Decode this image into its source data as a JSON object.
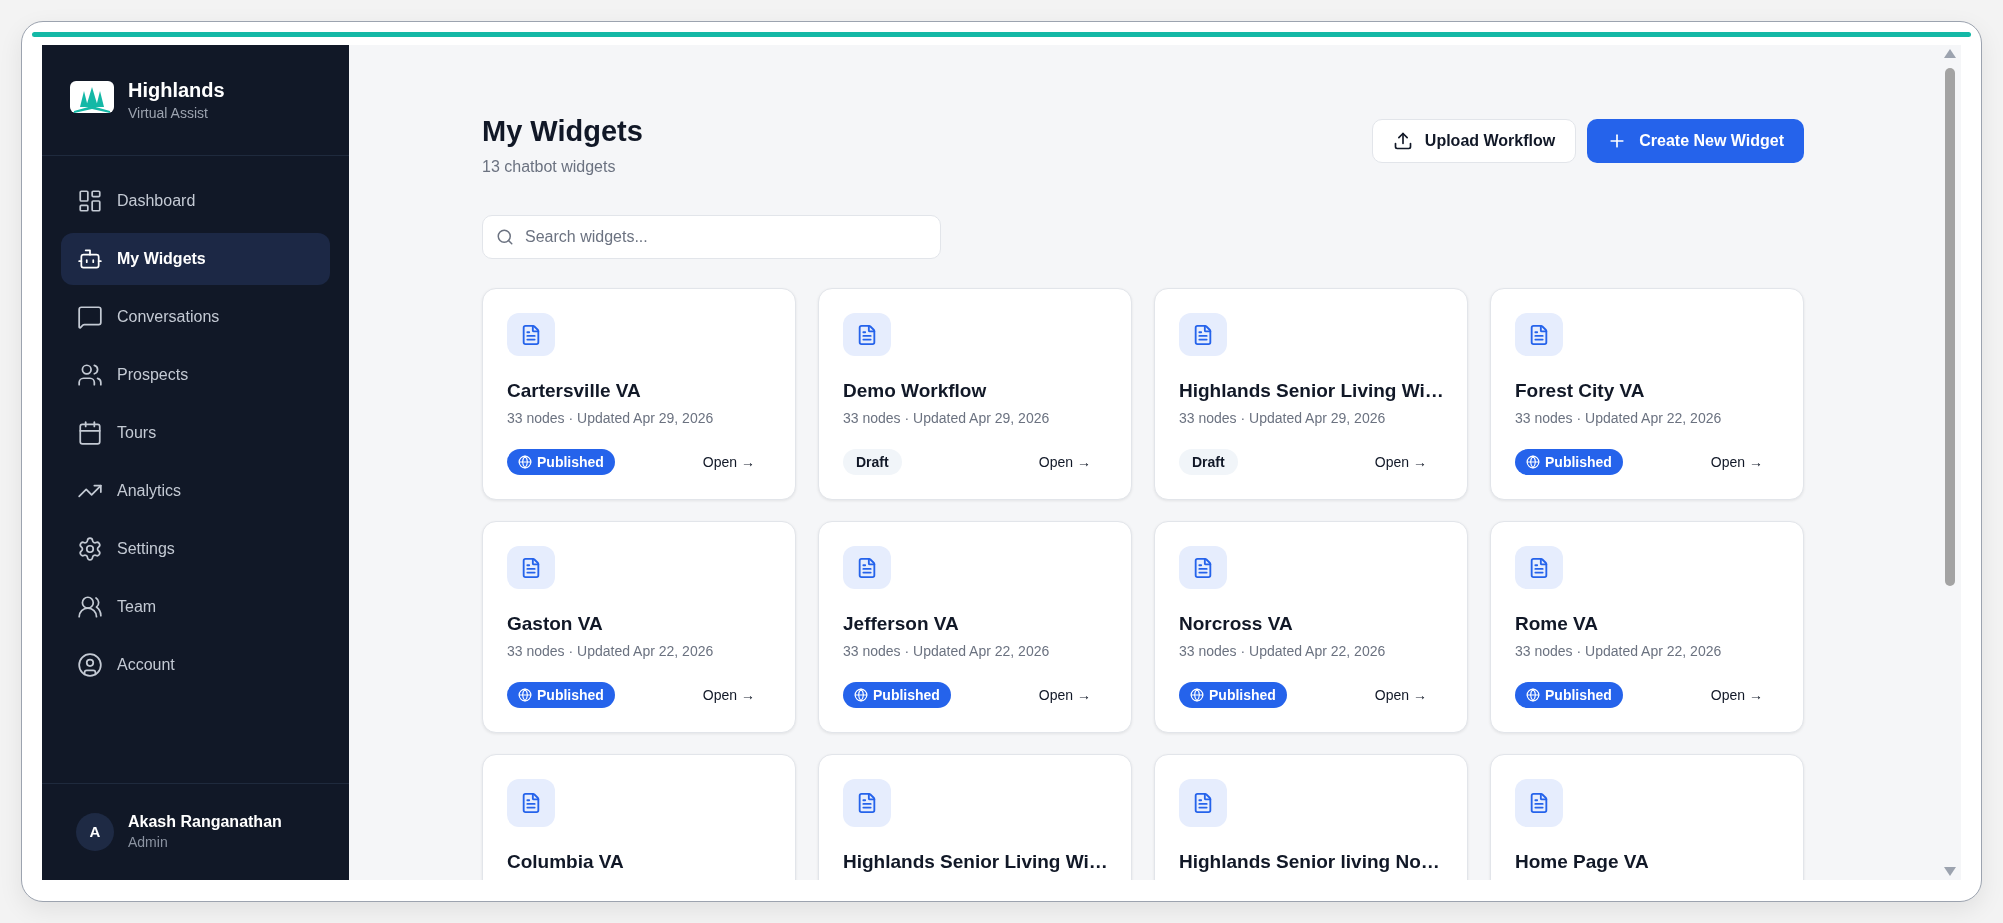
{
  "brand": {
    "name": "Highlands",
    "tagline": "Virtual Assist"
  },
  "sidebar": {
    "items": [
      {
        "label": "Dashboard",
        "selected": false
      },
      {
        "label": "My Widgets",
        "selected": true
      },
      {
        "label": "Conversations",
        "selected": false
      },
      {
        "label": "Prospects",
        "selected": false
      },
      {
        "label": "Tours",
        "selected": false
      },
      {
        "label": "Analytics",
        "selected": false
      },
      {
        "label": "Settings",
        "selected": false
      },
      {
        "label": "Team",
        "selected": false
      },
      {
        "label": "Account",
        "selected": false
      }
    ],
    "user": {
      "initial": "A",
      "name": "Akash Ranganathan",
      "role": "Admin"
    }
  },
  "header": {
    "title": "My Widgets",
    "subtitle": "13 chatbot widgets",
    "buttons": [
      {
        "label": "Upload Workflow",
        "kind": "secondary"
      },
      {
        "label": "Create New Widget",
        "kind": "primary"
      }
    ]
  },
  "search": {
    "placeholder": "Search widgets..."
  },
  "widgets": [
    {
      "title": "Cartersville VA",
      "meta": "33 nodes · Updated Apr 29, 2026",
      "status": {
        "label": "Published",
        "kind": "published"
      },
      "action": "Open →"
    },
    {
      "title": "Demo Workflow",
      "meta": "33 nodes · Updated Apr 29, 2026",
      "status": {
        "label": "Draft",
        "kind": "draft"
      },
      "action": "Open →"
    },
    {
      "title": "Highlands Senior Living Wi…",
      "meta": "33 nodes · Updated Apr 29, 2026",
      "status": {
        "label": "Draft",
        "kind": "draft"
      },
      "action": "Open →"
    },
    {
      "title": "Forest City VA",
      "meta": "33 nodes · Updated Apr 22, 2026",
      "status": {
        "label": "Published",
        "kind": "published"
      },
      "action": "Open →"
    },
    {
      "title": "Gaston VA",
      "meta": "33 nodes · Updated Apr 22, 2026",
      "status": {
        "label": "Published",
        "kind": "published"
      },
      "action": "Open →"
    },
    {
      "title": "Jefferson VA",
      "meta": "33 nodes · Updated Apr 22, 2026",
      "status": {
        "label": "Published",
        "kind": "published"
      },
      "action": "Open →"
    },
    {
      "title": "Norcross VA",
      "meta": "33 nodes · Updated Apr 22, 2026",
      "status": {
        "label": "Published",
        "kind": "published"
      },
      "action": "Open →"
    },
    {
      "title": "Rome VA",
      "meta": "33 nodes · Updated Apr 22, 2026",
      "status": {
        "label": "Published",
        "kind": "published"
      },
      "action": "Open →"
    },
    {
      "title": "Columbia VA"
    },
    {
      "title": "Highlands Senior Living Wi…"
    },
    {
      "title": "Highlands Senior living No…"
    },
    {
      "title": "Home Page VA"
    }
  ]
}
